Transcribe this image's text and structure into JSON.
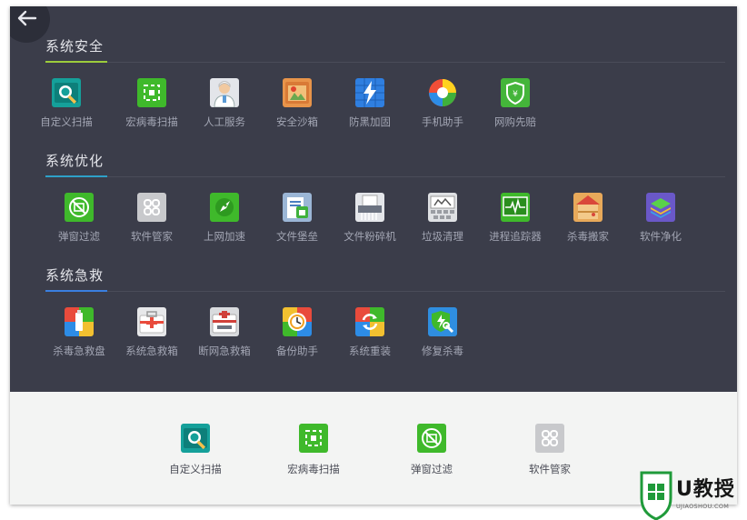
{
  "back": {
    "icon": "back-arrow-icon"
  },
  "sections": [
    {
      "title": "系统安全",
      "accent": "#9ccc3c",
      "tools": [
        {
          "label": "自定义扫描",
          "icon": "custom-scan-icon",
          "color": "#15a09a"
        },
        {
          "label": "宏病毒扫描",
          "icon": "macro-virus-scan-icon",
          "color": "#3fb92b"
        },
        {
          "label": "人工服务",
          "icon": "human-service-icon",
          "color": "#e3e5ea"
        },
        {
          "label": "安全沙箱",
          "icon": "sandbox-icon",
          "color": "#e8944a"
        },
        {
          "label": "防黑加固",
          "icon": "anti-hack-icon",
          "color": "#2f7fe0"
        },
        {
          "label": "手机助手",
          "icon": "phone-assistant-icon",
          "color": "#ffffff"
        },
        {
          "label": "网购先赔",
          "icon": "shopping-protection-icon",
          "color": "#44b53a"
        }
      ]
    },
    {
      "title": "系统优化",
      "accent": "#2ea0c8",
      "tools": [
        {
          "label": "弹窗过滤",
          "icon": "popup-filter-icon",
          "color": "#3fb92b"
        },
        {
          "label": "软件管家",
          "icon": "software-manager-icon",
          "color": "#c8c9cc"
        },
        {
          "label": "上网加速",
          "icon": "net-accelerate-icon",
          "color": "#3fb92b"
        },
        {
          "label": "文件堡垒",
          "icon": "file-fortress-icon",
          "color": "#9bb6d6"
        },
        {
          "label": "文件粉碎机",
          "icon": "file-shredder-icon",
          "color": "#e4e6ea"
        },
        {
          "label": "垃圾清理",
          "icon": "junk-clean-icon",
          "color": "#dfe1e4"
        },
        {
          "label": "进程追踪器",
          "icon": "process-tracker-icon",
          "color": "#3fb92b"
        },
        {
          "label": "杀毒搬家",
          "icon": "av-move-icon",
          "color": "#e8a95a"
        },
        {
          "label": "软件净化",
          "icon": "software-purify-icon",
          "color": "#6a58c8"
        }
      ]
    },
    {
      "title": "系统急救",
      "accent": "#3a7fe0",
      "tools": [
        {
          "label": "杀毒急救盘",
          "icon": "rescue-disk-icon",
          "color": "#e94b3c"
        },
        {
          "label": "系统急救箱",
          "icon": "system-rescue-box-icon",
          "color": "#e7e8ea"
        },
        {
          "label": "断网急救箱",
          "icon": "offline-rescue-box-icon",
          "color": "#d9dbde"
        },
        {
          "label": "备份助手",
          "icon": "backup-assistant-icon",
          "color": "#f0c030"
        },
        {
          "label": "系统重装",
          "icon": "system-reinstall-icon",
          "color": "#3b82e0"
        },
        {
          "label": "修复杀毒",
          "icon": "repair-av-icon",
          "color": "#2f8ee0"
        }
      ]
    }
  ],
  "favorites": [
    {
      "label": "自定义扫描",
      "icon": "custom-scan-icon"
    },
    {
      "label": "宏病毒扫描",
      "icon": "macro-virus-scan-icon"
    },
    {
      "label": "弹窗过滤",
      "icon": "popup-filter-icon"
    },
    {
      "label": "软件管家",
      "icon": "software-manager-icon"
    }
  ],
  "watermark": {
    "brand": "U教授",
    "url": "UJIAOSHOU.COM",
    "icon": "shield-logo-icon"
  }
}
